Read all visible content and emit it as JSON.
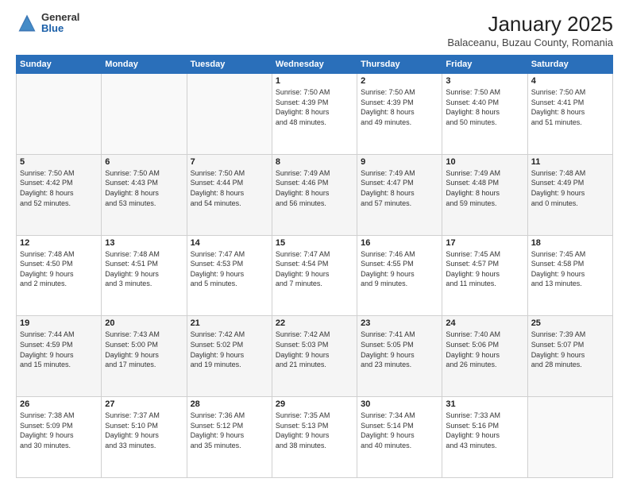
{
  "logo": {
    "general": "General",
    "blue": "Blue"
  },
  "title": "January 2025",
  "location": "Balaceanu, Buzau County, Romania",
  "weekdays": [
    "Sunday",
    "Monday",
    "Tuesday",
    "Wednesday",
    "Thursday",
    "Friday",
    "Saturday"
  ],
  "weeks": [
    [
      {
        "day": "",
        "info": ""
      },
      {
        "day": "",
        "info": ""
      },
      {
        "day": "",
        "info": ""
      },
      {
        "day": "1",
        "info": "Sunrise: 7:50 AM\nSunset: 4:39 PM\nDaylight: 8 hours\nand 48 minutes."
      },
      {
        "day": "2",
        "info": "Sunrise: 7:50 AM\nSunset: 4:39 PM\nDaylight: 8 hours\nand 49 minutes."
      },
      {
        "day": "3",
        "info": "Sunrise: 7:50 AM\nSunset: 4:40 PM\nDaylight: 8 hours\nand 50 minutes."
      },
      {
        "day": "4",
        "info": "Sunrise: 7:50 AM\nSunset: 4:41 PM\nDaylight: 8 hours\nand 51 minutes."
      }
    ],
    [
      {
        "day": "5",
        "info": "Sunrise: 7:50 AM\nSunset: 4:42 PM\nDaylight: 8 hours\nand 52 minutes."
      },
      {
        "day": "6",
        "info": "Sunrise: 7:50 AM\nSunset: 4:43 PM\nDaylight: 8 hours\nand 53 minutes."
      },
      {
        "day": "7",
        "info": "Sunrise: 7:50 AM\nSunset: 4:44 PM\nDaylight: 8 hours\nand 54 minutes."
      },
      {
        "day": "8",
        "info": "Sunrise: 7:49 AM\nSunset: 4:46 PM\nDaylight: 8 hours\nand 56 minutes."
      },
      {
        "day": "9",
        "info": "Sunrise: 7:49 AM\nSunset: 4:47 PM\nDaylight: 8 hours\nand 57 minutes."
      },
      {
        "day": "10",
        "info": "Sunrise: 7:49 AM\nSunset: 4:48 PM\nDaylight: 8 hours\nand 59 minutes."
      },
      {
        "day": "11",
        "info": "Sunrise: 7:48 AM\nSunset: 4:49 PM\nDaylight: 9 hours\nand 0 minutes."
      }
    ],
    [
      {
        "day": "12",
        "info": "Sunrise: 7:48 AM\nSunset: 4:50 PM\nDaylight: 9 hours\nand 2 minutes."
      },
      {
        "day": "13",
        "info": "Sunrise: 7:48 AM\nSunset: 4:51 PM\nDaylight: 9 hours\nand 3 minutes."
      },
      {
        "day": "14",
        "info": "Sunrise: 7:47 AM\nSunset: 4:53 PM\nDaylight: 9 hours\nand 5 minutes."
      },
      {
        "day": "15",
        "info": "Sunrise: 7:47 AM\nSunset: 4:54 PM\nDaylight: 9 hours\nand 7 minutes."
      },
      {
        "day": "16",
        "info": "Sunrise: 7:46 AM\nSunset: 4:55 PM\nDaylight: 9 hours\nand 9 minutes."
      },
      {
        "day": "17",
        "info": "Sunrise: 7:45 AM\nSunset: 4:57 PM\nDaylight: 9 hours\nand 11 minutes."
      },
      {
        "day": "18",
        "info": "Sunrise: 7:45 AM\nSunset: 4:58 PM\nDaylight: 9 hours\nand 13 minutes."
      }
    ],
    [
      {
        "day": "19",
        "info": "Sunrise: 7:44 AM\nSunset: 4:59 PM\nDaylight: 9 hours\nand 15 minutes."
      },
      {
        "day": "20",
        "info": "Sunrise: 7:43 AM\nSunset: 5:00 PM\nDaylight: 9 hours\nand 17 minutes."
      },
      {
        "day": "21",
        "info": "Sunrise: 7:42 AM\nSunset: 5:02 PM\nDaylight: 9 hours\nand 19 minutes."
      },
      {
        "day": "22",
        "info": "Sunrise: 7:42 AM\nSunset: 5:03 PM\nDaylight: 9 hours\nand 21 minutes."
      },
      {
        "day": "23",
        "info": "Sunrise: 7:41 AM\nSunset: 5:05 PM\nDaylight: 9 hours\nand 23 minutes."
      },
      {
        "day": "24",
        "info": "Sunrise: 7:40 AM\nSunset: 5:06 PM\nDaylight: 9 hours\nand 26 minutes."
      },
      {
        "day": "25",
        "info": "Sunrise: 7:39 AM\nSunset: 5:07 PM\nDaylight: 9 hours\nand 28 minutes."
      }
    ],
    [
      {
        "day": "26",
        "info": "Sunrise: 7:38 AM\nSunset: 5:09 PM\nDaylight: 9 hours\nand 30 minutes."
      },
      {
        "day": "27",
        "info": "Sunrise: 7:37 AM\nSunset: 5:10 PM\nDaylight: 9 hours\nand 33 minutes."
      },
      {
        "day": "28",
        "info": "Sunrise: 7:36 AM\nSunset: 5:12 PM\nDaylight: 9 hours\nand 35 minutes."
      },
      {
        "day": "29",
        "info": "Sunrise: 7:35 AM\nSunset: 5:13 PM\nDaylight: 9 hours\nand 38 minutes."
      },
      {
        "day": "30",
        "info": "Sunrise: 7:34 AM\nSunset: 5:14 PM\nDaylight: 9 hours\nand 40 minutes."
      },
      {
        "day": "31",
        "info": "Sunrise: 7:33 AM\nSunset: 5:16 PM\nDaylight: 9 hours\nand 43 minutes."
      },
      {
        "day": "",
        "info": ""
      }
    ]
  ]
}
